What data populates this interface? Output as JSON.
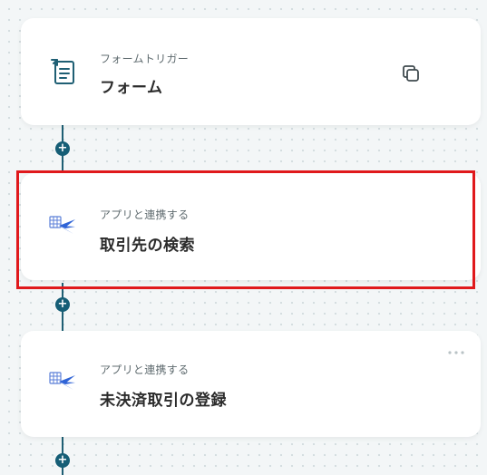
{
  "flow": {
    "steps": [
      {
        "subtitle": "フォームトリガー",
        "title": "フォーム",
        "icon": "form-icon"
      },
      {
        "subtitle": "アプリと連携する",
        "title": "取引先の検索",
        "icon": "app-integration-icon"
      },
      {
        "subtitle": "アプリと連携する",
        "title": "未決済取引の登録",
        "icon": "app-integration-icon"
      }
    ],
    "add_label": "+",
    "more_label": "..."
  },
  "colors": {
    "connector": "#1f5f74",
    "add_button": "#165e76",
    "highlight": "#e0191c",
    "form_icon": "#1f5f74",
    "app_icon_grid": "#5b7fd8",
    "app_icon_bird": "#2f63d6"
  }
}
